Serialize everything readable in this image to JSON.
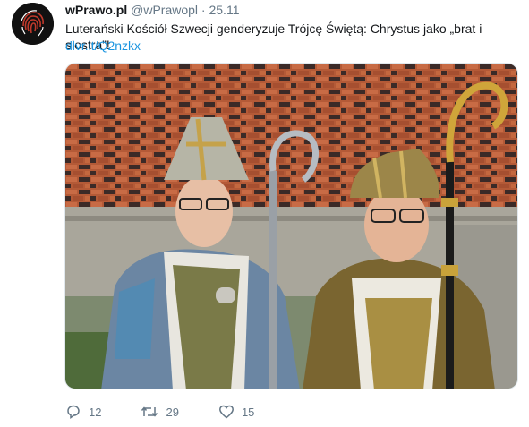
{
  "tweet": {
    "name": "wPrawo.pl",
    "handle": "@wPrawopl",
    "separator": "·",
    "date": "25.11",
    "text": "Luterański Kościół Szwecji genderyzuje Trójcę Świętą: Chrystus jako „brat i siostra”!",
    "link": "dlvr.it/Q2nzkx"
  },
  "actions": {
    "reply_icon": "reply-icon",
    "reply_count": "12",
    "retweet_icon": "retweet-icon",
    "retweet_count": "29",
    "like_icon": "heart-icon",
    "like_count": "15"
  },
  "colors": {
    "link": "#1b95e0",
    "muted": "#657786",
    "brick": "#b9603d"
  }
}
